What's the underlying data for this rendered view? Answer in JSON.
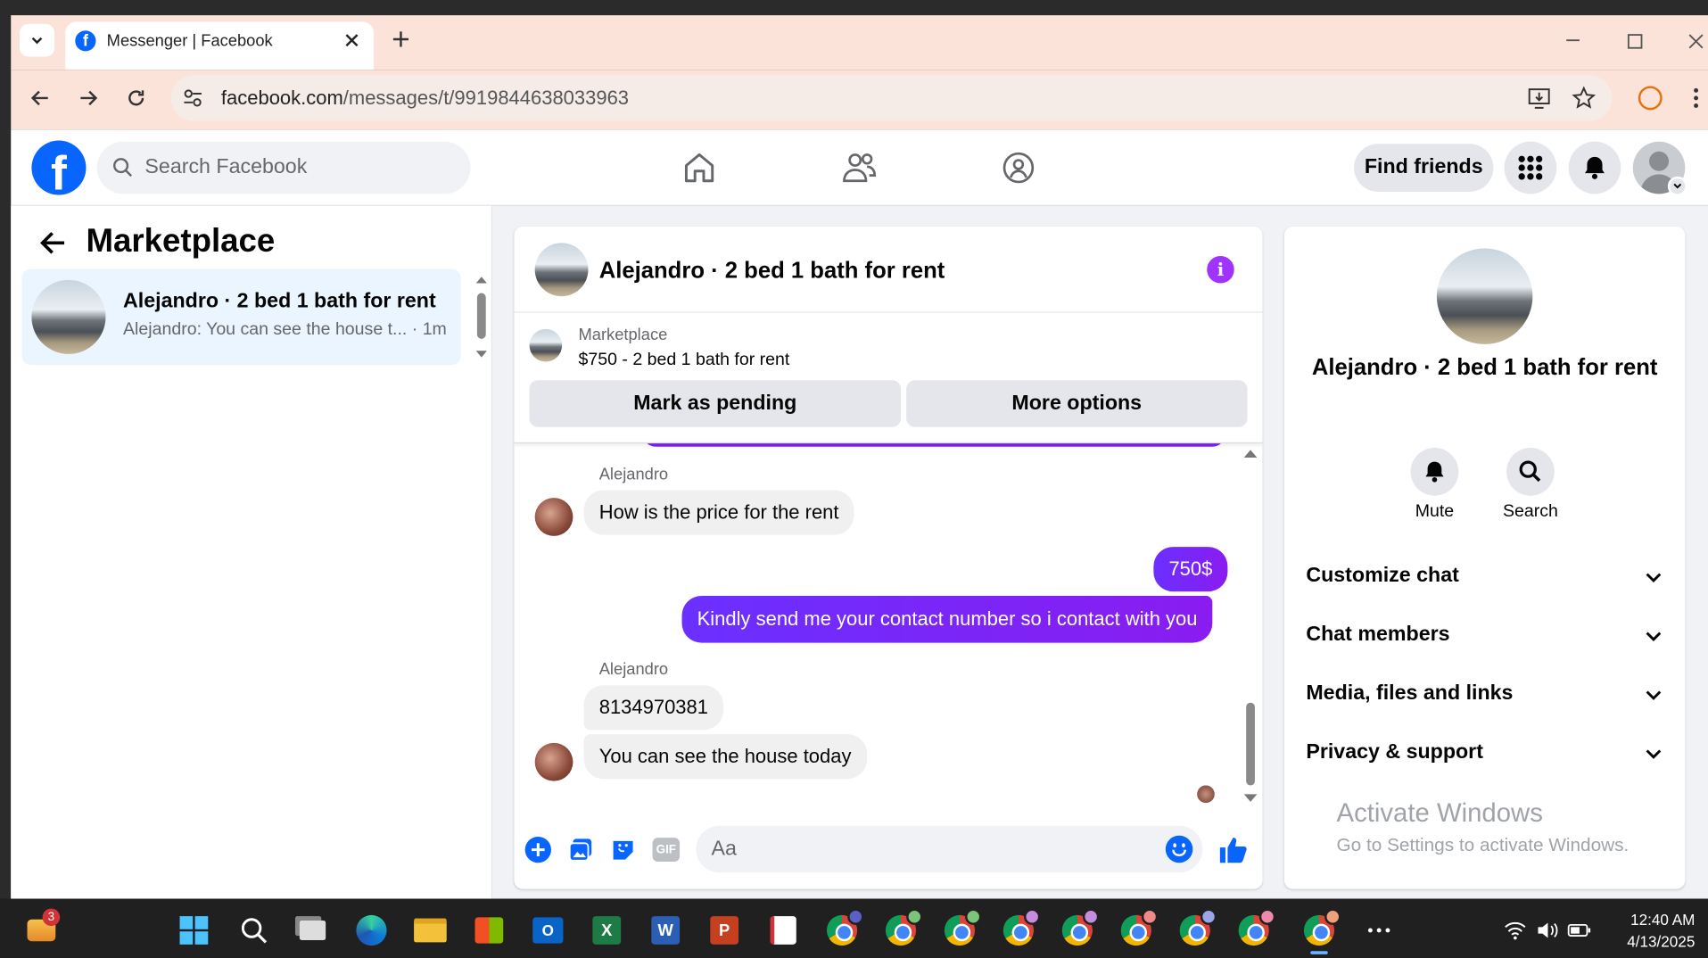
{
  "browser": {
    "tab_title": "Messenger | Facebook",
    "url_domain": "facebook.com",
    "url_path": "/messages/t/9919844638033963"
  },
  "fb": {
    "search_placeholder": "Search Facebook",
    "find_friends": "Find friends"
  },
  "left": {
    "title": "Marketplace",
    "conv": {
      "name": "Alejandro · 2 bed 1 bath for rent",
      "preview": "Alejandro: You can see the house t... · 1m"
    }
  },
  "chat": {
    "header_title": "Alejandro · 2 bed 1 bath for rent",
    "listing": {
      "label": "Marketplace",
      "title": "$750 - 2 bed 1 bath for rent",
      "btn_pending": "Mark as pending",
      "btn_more": "More options"
    },
    "messages": [
      {
        "sender": "Alejandro",
        "text": "How is the price for the rent"
      },
      {
        "text": "750$"
      },
      {
        "text": "Kindly send me your contact number so i contact with you"
      },
      {
        "sender": "Alejandro",
        "text": "8134970381"
      },
      {
        "text": "You can see the house today"
      }
    ],
    "input_placeholder": "Aa"
  },
  "right": {
    "name": "Alejandro · 2 bed 1 bath for rent",
    "mute": "Mute",
    "search": "Search",
    "sections": [
      "Customize chat",
      "Chat members",
      "Media, files and links",
      "Privacy & support"
    ],
    "watermark_title": "Activate Windows",
    "watermark_sub": "Go to Settings to activate Windows."
  },
  "taskbar": {
    "badge": "3",
    "time": "12:40 AM",
    "date": "4/13/2025"
  },
  "colors": {
    "fb_blue": "#0866ff",
    "messenger_purple": "#7a21ff"
  }
}
